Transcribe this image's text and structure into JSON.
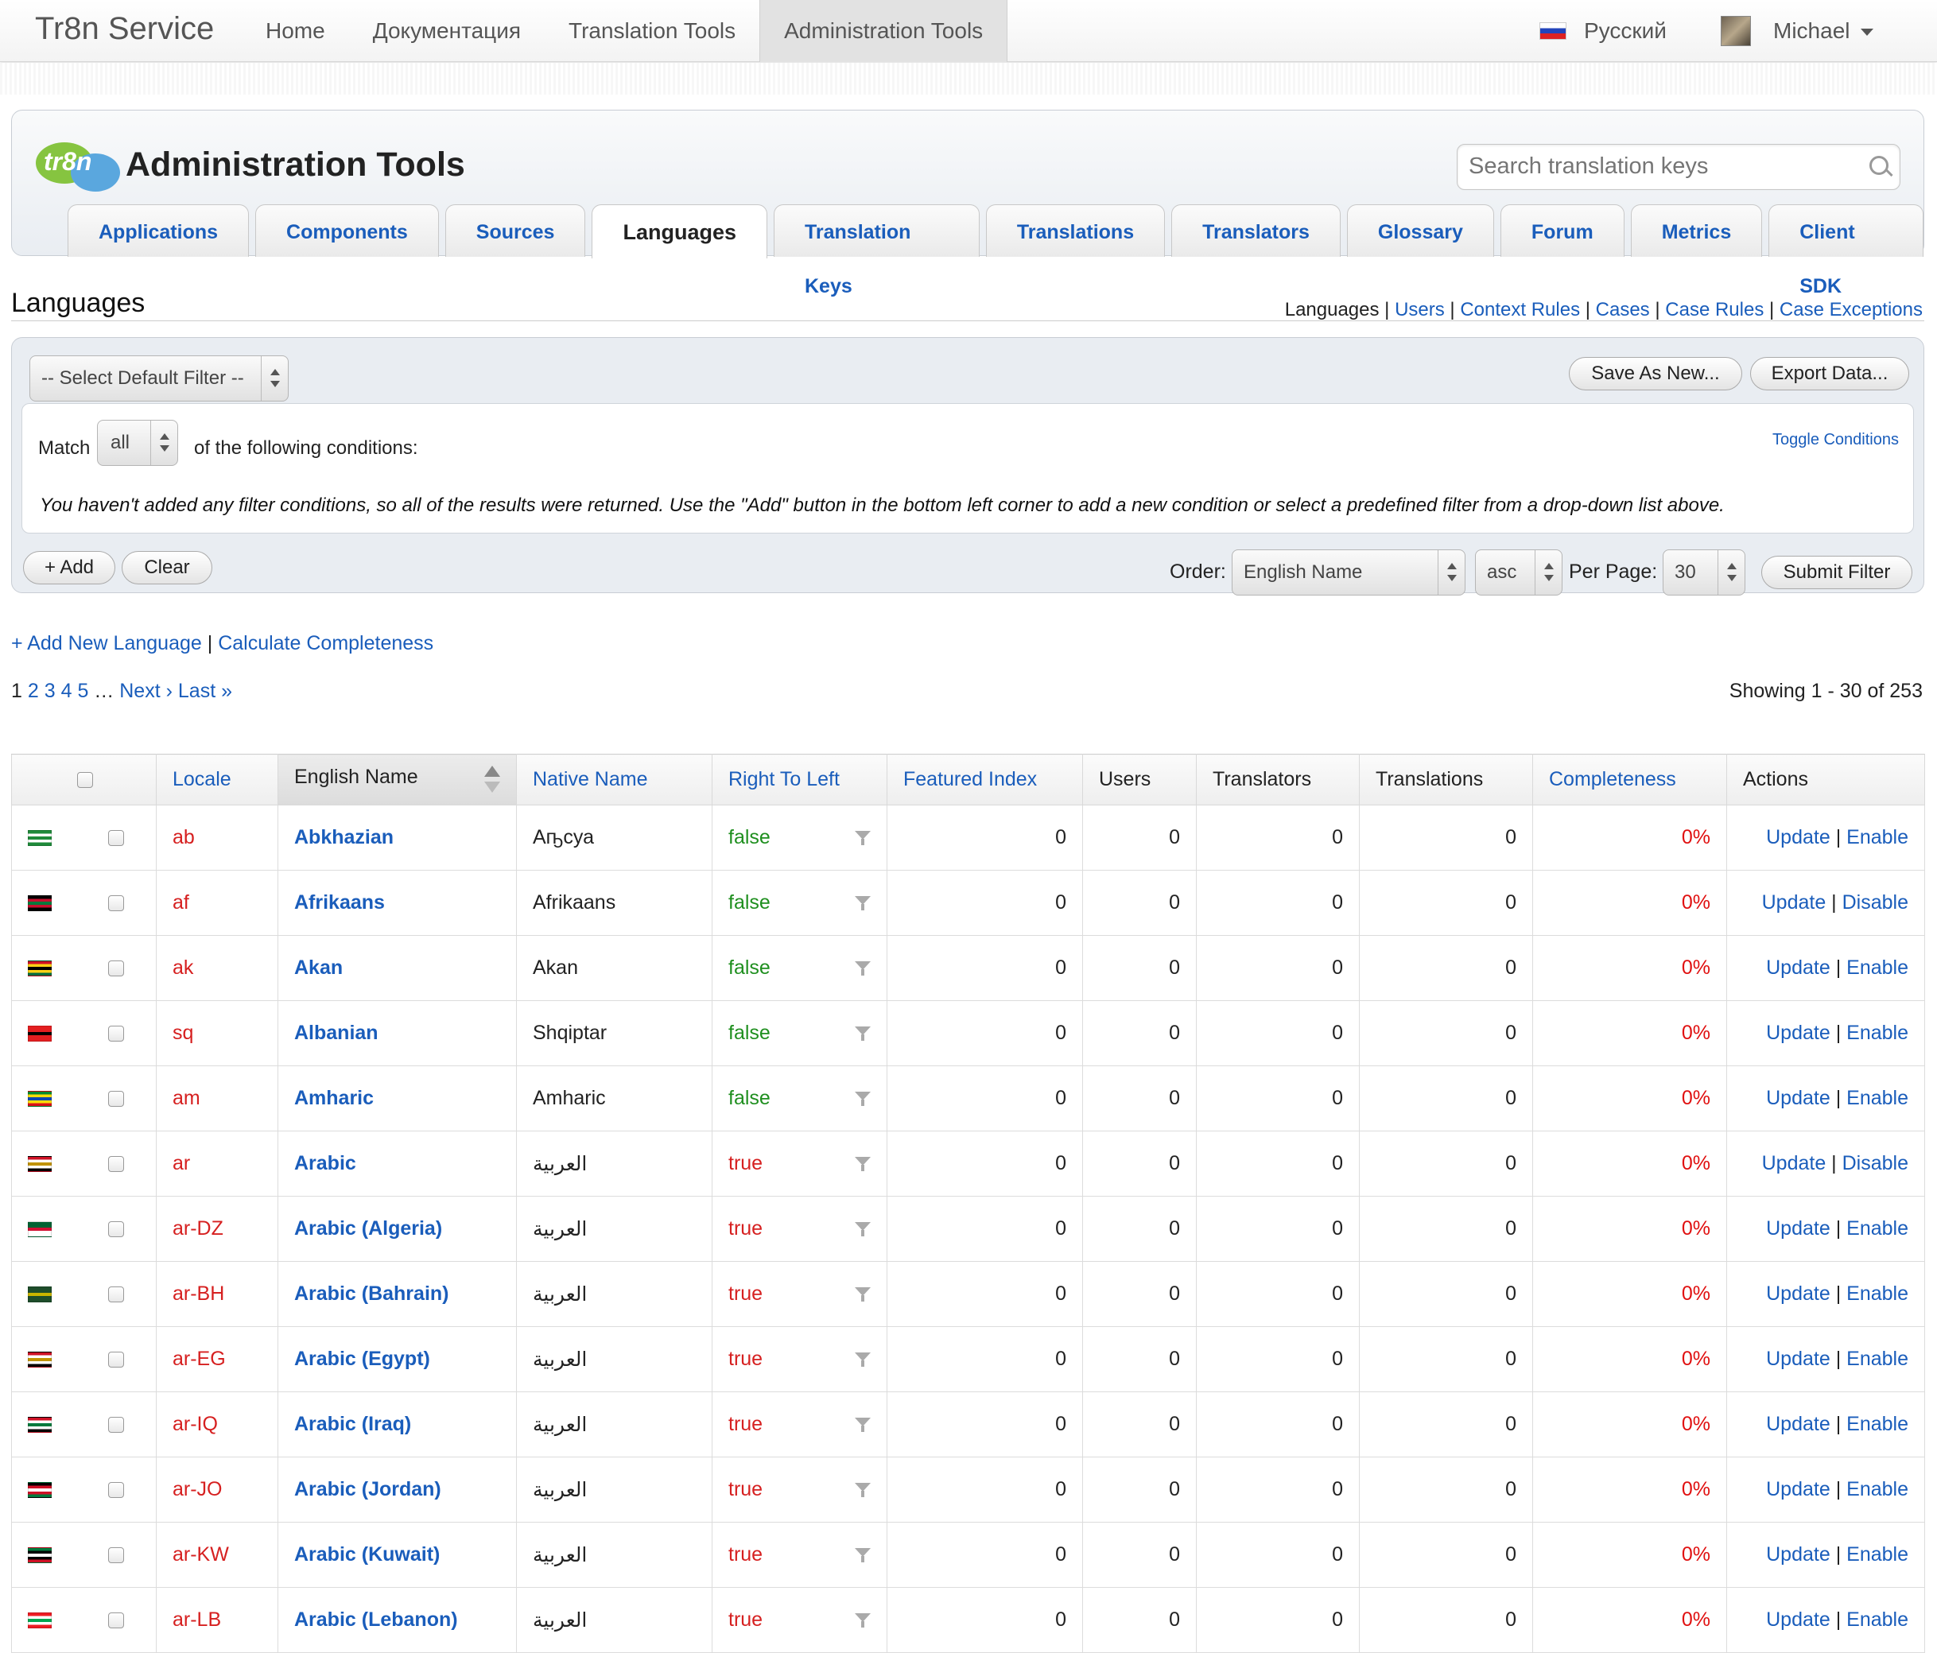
{
  "topbar": {
    "brand": "Tr8n Service",
    "nav": [
      "Home",
      "Документация",
      "Translation Tools",
      "Administration Tools"
    ],
    "active_nav": "Administration Tools",
    "language": "Русский",
    "user": "Michael"
  },
  "header": {
    "logo_text": "tr8n",
    "title": "Administration Tools",
    "search_placeholder": "Search translation keys",
    "tabs": [
      "Applications",
      "Components",
      "Sources",
      "Languages",
      "Translation Keys",
      "Translations",
      "Translators",
      "Glossary",
      "Forum",
      "Metrics",
      "Client SDK"
    ],
    "active_tab": "Languages"
  },
  "section": {
    "title": "Languages",
    "current_link": "Languages",
    "links": [
      "Users",
      "Context Rules",
      "Cases",
      "Case Rules",
      "Case Exceptions"
    ]
  },
  "filter": {
    "default_filter": "-- Select Default Filter --",
    "save_as_new": "Save As New...",
    "export_data": "Export Data...",
    "match_label": "Match",
    "match_value": "all",
    "following_label": "of the following conditions:",
    "toggle_conditions": "Toggle Conditions",
    "note": "You haven't added any filter conditions, so all of the results were returned. Use the \"Add\" button in the bottom left corner to add a new condition or select a predefined filter from a drop-down list above.",
    "add": "+ Add",
    "clear": "Clear",
    "order_label": "Order:",
    "order_value": "English Name",
    "direction_value": "asc",
    "per_page_label": "Per Page:",
    "per_page_value": "30",
    "submit": "Submit Filter"
  },
  "actions_links": {
    "add_language": "+ Add New Language",
    "calculate": "Calculate Completeness"
  },
  "pagination": {
    "current": "1",
    "pages": [
      "2",
      "3",
      "4",
      "5"
    ],
    "ellipsis": "…",
    "next": "Next ›",
    "last": "Last »",
    "showing": "Showing 1 - 30 of 253"
  },
  "table": {
    "columns": [
      "Locale",
      "English Name",
      "Native Name",
      "Right To Left",
      "Featured Index",
      "Users",
      "Translators",
      "Translations",
      "Completeness",
      "Actions"
    ],
    "update_label": "Update",
    "rows": [
      {
        "locale": "ab",
        "english": "Abkhazian",
        "native": "Аҧсуа",
        "rtl": "false",
        "featured": "0",
        "users": "0",
        "translators": "0",
        "translations": "0",
        "completeness": "0%",
        "toggle": "Enable",
        "flag": [
          "#1f8a3a",
          "#ffffff",
          "#1f8a3a",
          "#ffffff",
          "#1f8a3a"
        ]
      },
      {
        "locale": "af",
        "english": "Afrikaans",
        "native": "Afrikaans",
        "rtl": "false",
        "featured": "0",
        "users": "0",
        "translators": "0",
        "translations": "0",
        "completeness": "0%",
        "toggle": "Disable",
        "flag": [
          "#000000",
          "#c8102e",
          "#007a3d",
          "#c8102e",
          "#000000"
        ]
      },
      {
        "locale": "ak",
        "english": "Akan",
        "native": "Akan",
        "rtl": "false",
        "featured": "0",
        "users": "0",
        "translators": "0",
        "translations": "0",
        "completeness": "0%",
        "toggle": "Enable",
        "flag": [
          "#ce1126",
          "#fcd116",
          "#000000",
          "#fcd116",
          "#006b3f"
        ]
      },
      {
        "locale": "sq",
        "english": "Albanian",
        "native": "Shqiptar",
        "rtl": "false",
        "featured": "0",
        "users": "0",
        "translators": "0",
        "translations": "0",
        "completeness": "0%",
        "toggle": "Enable",
        "flag": [
          "#e41e20",
          "#e41e20",
          "#000000",
          "#e41e20",
          "#e41e20"
        ]
      },
      {
        "locale": "am",
        "english": "Amharic",
        "native": "Amharic",
        "rtl": "false",
        "featured": "0",
        "users": "0",
        "translators": "0",
        "translations": "0",
        "completeness": "0%",
        "toggle": "Enable",
        "flag": [
          "#078930",
          "#fcdd09",
          "#0f47af",
          "#fcdd09",
          "#da121a"
        ]
      },
      {
        "locale": "ar",
        "english": "Arabic",
        "native": "العربية",
        "rtl": "true",
        "featured": "0",
        "users": "0",
        "translators": "0",
        "translations": "0",
        "completeness": "0%",
        "toggle": "Disable",
        "flag": [
          "#ce1126",
          "#ffffff",
          "#c09300",
          "#ffffff",
          "#000000"
        ]
      },
      {
        "locale": "ar-DZ",
        "english": "Arabic (Algeria)",
        "native": "العربية",
        "rtl": "true",
        "featured": "0",
        "users": "0",
        "translators": "0",
        "translations": "0",
        "completeness": "0%",
        "toggle": "Enable",
        "flag": [
          "#006233",
          "#006233",
          "#d21034",
          "#ffffff",
          "#ffffff"
        ]
      },
      {
        "locale": "ar-BH",
        "english": "Arabic (Bahrain)",
        "native": "العربية",
        "rtl": "true",
        "featured": "0",
        "users": "0",
        "translators": "0",
        "translations": "0",
        "completeness": "0%",
        "toggle": "Enable",
        "flag": [
          "#1e4d2b",
          "#1e4d2b",
          "#c8b400",
          "#1e4d2b",
          "#1e4d2b"
        ]
      },
      {
        "locale": "ar-EG",
        "english": "Arabic (Egypt)",
        "native": "العربية",
        "rtl": "true",
        "featured": "0",
        "users": "0",
        "translators": "0",
        "translations": "0",
        "completeness": "0%",
        "toggle": "Enable",
        "flag": [
          "#ce1126",
          "#ffffff",
          "#c09300",
          "#ffffff",
          "#000000"
        ]
      },
      {
        "locale": "ar-IQ",
        "english": "Arabic (Iraq)",
        "native": "العربية",
        "rtl": "true",
        "featured": "0",
        "users": "0",
        "translators": "0",
        "translations": "0",
        "completeness": "0%",
        "toggle": "Enable",
        "flag": [
          "#ce1126",
          "#ffffff",
          "#007a3d",
          "#ffffff",
          "#000000"
        ]
      },
      {
        "locale": "ar-JO",
        "english": "Arabic (Jordan)",
        "native": "العربية",
        "rtl": "true",
        "featured": "0",
        "users": "0",
        "translators": "0",
        "translations": "0",
        "completeness": "0%",
        "toggle": "Enable",
        "flag": [
          "#000000",
          "#ce1126",
          "#ffffff",
          "#ce1126",
          "#007a3d"
        ]
      },
      {
        "locale": "ar-KW",
        "english": "Arabic (Kuwait)",
        "native": "العربية",
        "rtl": "true",
        "featured": "0",
        "users": "0",
        "translators": "0",
        "translations": "0",
        "completeness": "0%",
        "toggle": "Enable",
        "flag": [
          "#007a3d",
          "#000000",
          "#ffffff",
          "#000000",
          "#ce1126"
        ]
      },
      {
        "locale": "ar-LB",
        "english": "Arabic (Lebanon)",
        "native": "العربية",
        "rtl": "true",
        "featured": "0",
        "users": "0",
        "translators": "0",
        "translations": "0",
        "completeness": "0%",
        "toggle": "Enable",
        "flag": [
          "#ed1c24",
          "#ffffff",
          "#00a651",
          "#ffffff",
          "#ed1c24"
        ]
      }
    ]
  }
}
